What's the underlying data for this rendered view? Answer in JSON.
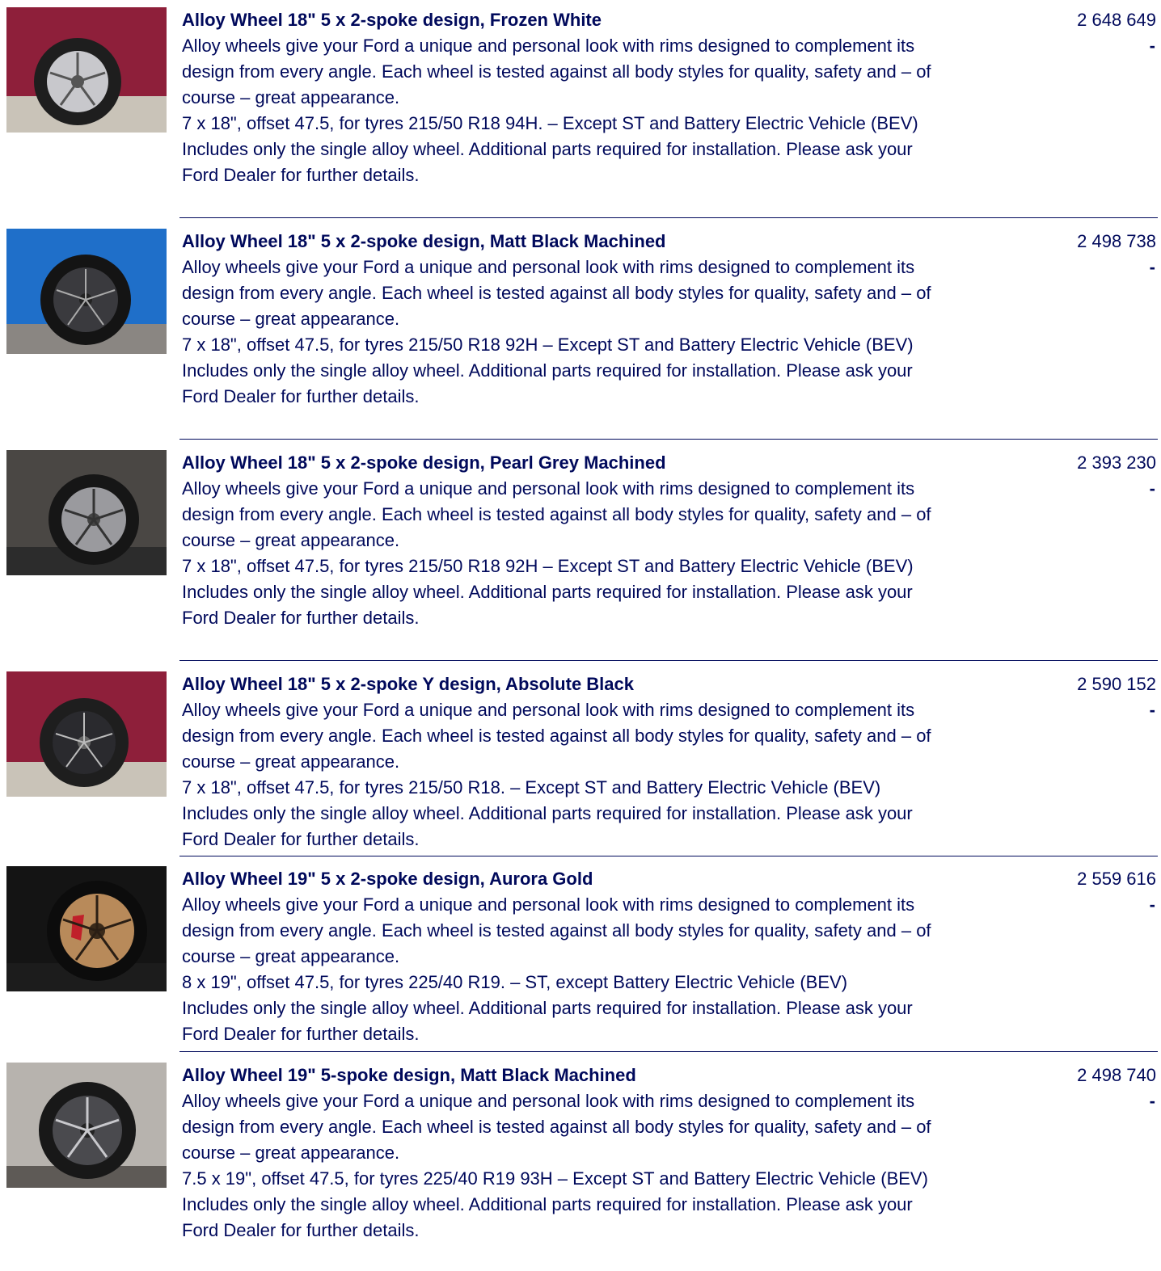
{
  "items": [
    {
      "title": "Alloy Wheel 18\" 5 x 2-spoke design, Frozen White",
      "description": "Alloy wheels give your Ford a unique and personal look with rims designed to complement its design from every angle. Each wheel is tested against all body styles for quality, safety and – of course – great appearance.",
      "spec": "7 x 18\", offset 47.5, for tyres 215/50 R18 94H. – Except ST and Battery Electric Vehicle (BEV)",
      "note": "Includes only the single alloy wheel. Additional parts required for installation. Please ask your Ford Dealer for further details.",
      "code": "2 648 649",
      "price": "-",
      "image": {
        "body": "#8e1f3a",
        "ground": "#c9c3b8",
        "rim": "#c8c8cc",
        "tyre": "#1e1e1e"
      }
    },
    {
      "title": "Alloy Wheel 18\" 5 x 2-spoke design, Matt Black Machined",
      "description": "Alloy wheels give your Ford a unique and personal look with rims designed to complement its design from every angle. Each wheel is tested against all body styles for quality, safety and – of course – great appearance.",
      "spec": "7 x 18\", offset 47.5, for tyres 215/50 R18 92H – Except ST and Battery Electric Vehicle (BEV)",
      "note": "Includes only the single alloy wheel. Additional parts required for installation. Please ask your Ford Dealer for further details.",
      "code": "2 498 738",
      "price": "-",
      "image": {
        "body": "#1f6fc9",
        "ground": "#8a8682",
        "rim": "#3a3a3e",
        "tyre": "#141414"
      }
    },
    {
      "title": "Alloy Wheel 18\" 5 x 2-spoke design, Pearl Grey Machined",
      "description": "Alloy wheels give your Ford a unique and personal look with rims designed to complement its design from every angle. Each wheel is tested against all body styles for quality, safety and – of course – great appearance.",
      "spec": "7 x 18\", offset 47.5, for tyres 215/50 R18 92H – Except ST and Battery Electric Vehicle (BEV)",
      "note": "Includes only the single alloy wheel. Additional parts required for installation. Please ask your Ford Dealer for further details.",
      "code": "2 393 230",
      "price": "-",
      "image": {
        "body": "#4a4744",
        "ground": "#2c2c2c",
        "rim": "#9a9a9e",
        "tyre": "#161616"
      }
    },
    {
      "title": "Alloy Wheel 18\" 5 x 2-spoke Y design, Absolute Black",
      "description": "Alloy wheels give your Ford a unique and personal look with rims designed to complement its design from every angle. Each wheel is tested against all body styles for quality, safety and – of course – great appearance.",
      "spec": "7 x 18\", offset 47.5, for tyres 215/50 R18. – Except ST and Battery Electric Vehicle (BEV)",
      "note": "Includes only the single alloy wheel. Additional parts required for installation. Please ask your Ford Dealer for further details.",
      "code": "2 590 152",
      "price": "-",
      "image": {
        "body": "#8e1f3a",
        "ground": "#c9c3b8",
        "rim": "#2a2a2e",
        "tyre": "#1e1e1e"
      }
    },
    {
      "title": "Alloy Wheel 19\" 5 x 2-spoke design, Aurora Gold",
      "description": "Alloy wheels give your Ford a unique and personal look with rims designed to complement its design from every angle. Each wheel is tested against all body styles for quality, safety and – of course – great appearance.",
      "spec": "8 x 19\", offset 47.5, for tyres 225/40 R19. – ST, except Battery Electric Vehicle (BEV)",
      "note": "Includes only the single alloy wheel. Additional parts required for installation. Please ask your Ford Dealer for further details.",
      "code": "2 559 616",
      "price": "-",
      "image": {
        "body": "#141414",
        "ground": "#1c1c1c",
        "rim": "#b88a5a",
        "tyre": "#0c0c0c"
      }
    },
    {
      "title": "Alloy Wheel 19\" 5-spoke design, Matt Black Machined",
      "description": "Alloy wheels give your Ford a unique and personal look with rims designed to complement its design from every angle. Each wheel is tested against all body styles for quality, safety and – of course – great appearance.",
      "spec": "7.5 x 19\", offset 47.5, for tyres 225/40 R19 93H – Except ST and Battery Electric Vehicle (BEV)",
      "note": "Includes only the single alloy wheel. Additional parts required for installation. Please ask your Ford Dealer for further details.",
      "code": "2 498 740",
      "price": "-",
      "image": {
        "body": "#b7b3ae",
        "ground": "#5e5a56",
        "rim": "#4a4a4e",
        "tyre": "#181818"
      }
    }
  ]
}
